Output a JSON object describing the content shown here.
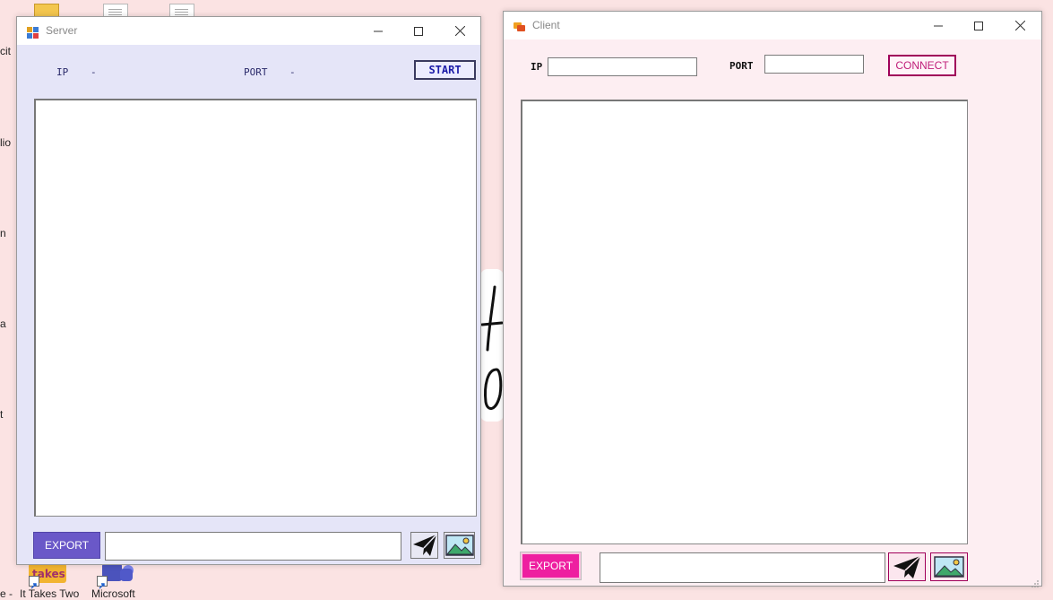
{
  "desktop": {
    "edge_labels": [
      "cit",
      "lio",
      "n",
      "a",
      "t",
      "e -"
    ],
    "shortcuts": [
      {
        "label": "It Takes Two",
        "icon": "it-takes-two-game-icon"
      },
      {
        "label": "Microsoft",
        "icon": "microsoft-teams-icon"
      }
    ]
  },
  "server": {
    "title": "Server",
    "ip_label": "IP",
    "ip_value": "-",
    "port_label": "PORT",
    "port_value": "-",
    "start_label": "START",
    "export_label": "EXPORT",
    "message_value": "",
    "colors": {
      "background": "#e5e5f8",
      "accent": "#2f2fb0",
      "export_bg": "#6a58c8"
    }
  },
  "client": {
    "title": "Client",
    "ip_label": "IP",
    "ip_value": "",
    "port_label": "PORT",
    "port_value": "",
    "connect_label": "CONNECT",
    "export_label": "EXPORT",
    "message_value": "",
    "colors": {
      "background": "#fdeef2",
      "accent": "#a0005a",
      "export_bg": "#ee1fa0"
    }
  }
}
